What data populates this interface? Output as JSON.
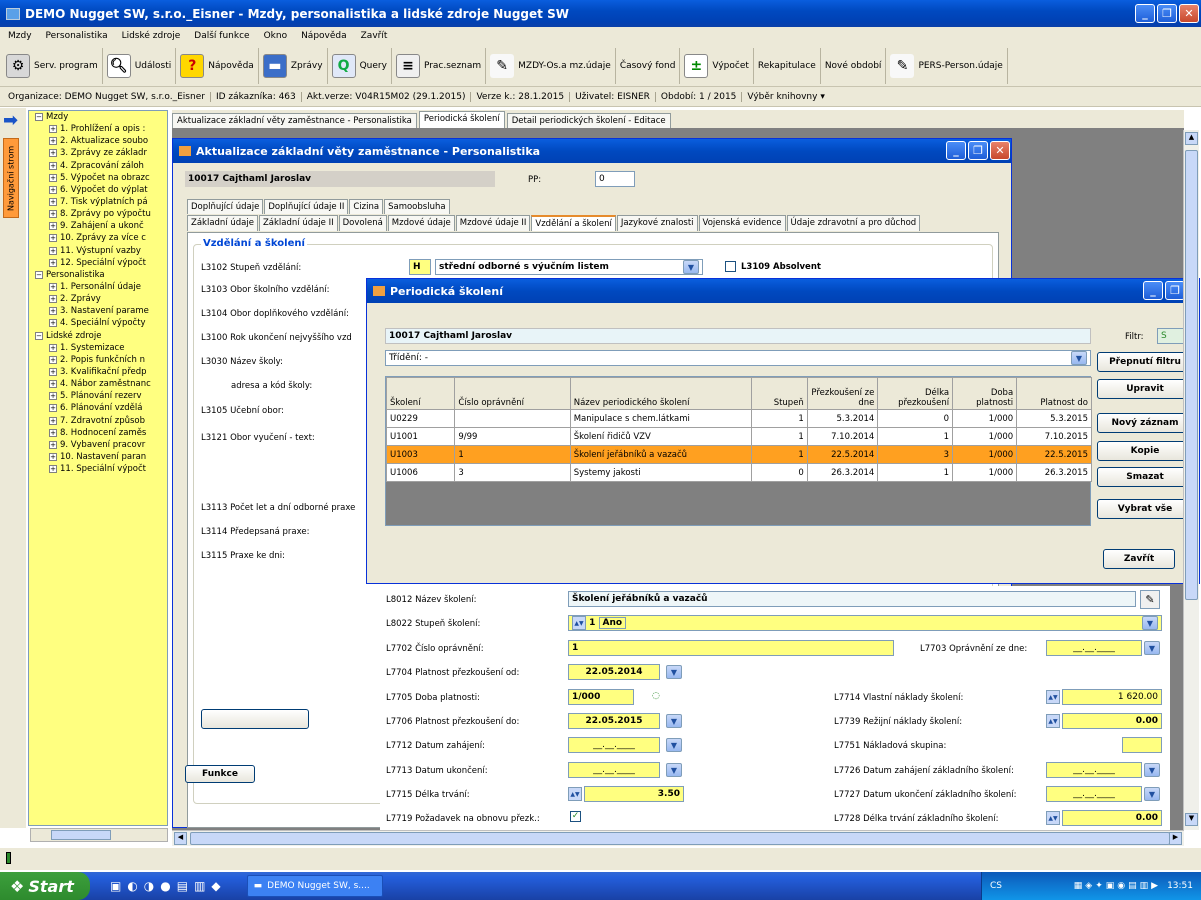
{
  "app": {
    "title": "DEMO Nugget SW, s.r.o._Eisner - Mzdy, personalistika a lidské zdroje Nugget SW"
  },
  "menu": [
    "Mzdy",
    "Personalistika",
    "Lidské zdroje",
    "Další funkce",
    "Okno",
    "Nápověda",
    "Zavřít"
  ],
  "toolbar": [
    {
      "label": "Serv. program",
      "icon": "tools-icon"
    },
    {
      "label": "Události",
      "icon": "magnifier-icon"
    },
    {
      "label": "Nápověda",
      "icon": "help-icon"
    },
    {
      "label": "Zprávy",
      "icon": "printer-icon"
    },
    {
      "label": "Query",
      "icon": "query-icon"
    },
    {
      "label": "Prac.seznam",
      "icon": "list-icon"
    },
    {
      "label": "MZDY-Os.a mz.údaje",
      "icon": "pen-icon"
    },
    {
      "label": "Časový fond",
      "icon": ""
    },
    {
      "label": "Výpočet",
      "icon": "calc-icon"
    },
    {
      "label": "Rekapitulace",
      "icon": ""
    },
    {
      "label": "Nové období",
      "icon": ""
    },
    {
      "label": "PERS-Person.údaje",
      "icon": "pen-icon"
    }
  ],
  "infobar": [
    "Organizace: DEMO Nugget SW, s.r.o._Eisner",
    "ID zákazníka: 463",
    "Akt.verze: V04R15M02 (29.1.2015)",
    "Verze k.: 28.1.2015",
    "Uživatel: EISNER",
    "Období: 1 / 2015",
    "Výběr knihovny ▾"
  ],
  "nav": {
    "tab_label": "Navigační strom"
  },
  "tree": [
    {
      "t": "Mzdy",
      "lvl": 0,
      "sign": "−"
    },
    {
      "t": "1. Prohlížení a opis :",
      "lvl": 1,
      "sign": "+"
    },
    {
      "t": "2. Aktualizace soubo",
      "lvl": 1,
      "sign": "+"
    },
    {
      "t": "3. Zprávy ze základr",
      "lvl": 1,
      "sign": "+"
    },
    {
      "t": "4. Zpracování záloh",
      "lvl": 1,
      "sign": "+"
    },
    {
      "t": "5. Výpočet na obrazc",
      "lvl": 1,
      "sign": "+"
    },
    {
      "t": "6. Výpočet do výplat",
      "lvl": 1,
      "sign": "+"
    },
    {
      "t": "7. Tisk výplatních pá",
      "lvl": 1,
      "sign": "+"
    },
    {
      "t": "8. Zprávy po výpočtu",
      "lvl": 1,
      "sign": "+"
    },
    {
      "t": "9. Zahájení a ukonč",
      "lvl": 1,
      "sign": "+"
    },
    {
      "t": "10. Zprávy za více c",
      "lvl": 1,
      "sign": "+"
    },
    {
      "t": "11. Výstupní vazby",
      "lvl": 1,
      "sign": "+"
    },
    {
      "t": "12. Speciální výpočt",
      "lvl": 1,
      "sign": "+"
    },
    {
      "t": "Personalistika",
      "lvl": 0,
      "sign": "−"
    },
    {
      "t": "1. Personální údaje",
      "lvl": 1,
      "sign": "+"
    },
    {
      "t": "2. Zprávy",
      "lvl": 1,
      "sign": "+"
    },
    {
      "t": "3. Nastavení parame",
      "lvl": 1,
      "sign": "+"
    },
    {
      "t": "4. Speciální výpočty",
      "lvl": 1,
      "sign": "+"
    },
    {
      "t": "Lidské zdroje",
      "lvl": 0,
      "sign": "−"
    },
    {
      "t": "1. Systemizace",
      "lvl": 1,
      "sign": "+"
    },
    {
      "t": "2. Popis funkčních n",
      "lvl": 1,
      "sign": "+"
    },
    {
      "t": "3. Kvalifikační předp",
      "lvl": 1,
      "sign": "+"
    },
    {
      "t": "4. Nábor zaměstnanc",
      "lvl": 1,
      "sign": "+"
    },
    {
      "t": "5. Plánování rezerv",
      "lvl": 1,
      "sign": "+"
    },
    {
      "t": "6. Plánování vzdělá",
      "lvl": 1,
      "sign": "+"
    },
    {
      "t": "7. Zdravotní způsob",
      "lvl": 1,
      "sign": "+"
    },
    {
      "t": "8. Hodnocení zaměs",
      "lvl": 1,
      "sign": "+"
    },
    {
      "t": "9. Vybavení pracovr",
      "lvl": 1,
      "sign": "+"
    },
    {
      "t": "10. Nastavení paran",
      "lvl": 1,
      "sign": "+"
    },
    {
      "t": "11. Speciální výpočt",
      "lvl": 1,
      "sign": "+"
    }
  ],
  "mditabs": [
    "Aktualizace základní věty zaměstnance - Personalistika",
    "Periodická školení",
    "Detail periodických školení - Editace"
  ],
  "win1": {
    "title": "Aktualizace základní věty zaměstnance - Personalistika",
    "employee": "10017   Cajthaml Jaroslav",
    "pp_label": "PP:",
    "pp_value": "0",
    "tabs1": [
      "Doplňující údaje",
      "Doplňující údaje II",
      "Cizina",
      "Samoobsluha"
    ],
    "tabs2": [
      "Základní údaje",
      "Základní údaje II",
      "Dovolená",
      "Mzdové údaje",
      "Mzdové údaje II",
      "Vzdělání a školení",
      "Jazykové znalosti",
      "Vojenská evidence",
      "Údaje zdravotní a pro důchod"
    ],
    "group": "Vzdělání a školení",
    "l3102": "L3102 Stupeň vzdělání:",
    "l3102_code": "H",
    "l3102_value": "střední odborné s výučním listem",
    "l3109": "L3109 Absolvent",
    "l3103": "L3103 Obor školního vzdělání:",
    "l3104": "L3104 Obor doplňkového vzdělání:",
    "l3100": "L3100 Rok ukončení nejvyššího vzd",
    "l3030": "L3030 Název školy:",
    "adresa": "adresa a kód školy:",
    "l3105": "L3105 Učební obor:",
    "l3121": "L3121 Obor vyučení - text:",
    "l3113": "L3113 Počet let a dní odborné praxe",
    "l3114": "L3114 Předepsaná praxe:",
    "l3115": "L3115 Praxe ke dni:",
    "funkce": "Funkce"
  },
  "win2": {
    "title": "Periodická školení",
    "employee": "10017   Cajthaml Jaroslav",
    "filtr_label": "Filtr:",
    "filtr_value": "S",
    "trideni": "Třídění: -",
    "cols": [
      "Školení",
      "Číslo oprávnění",
      "Název periodického školení",
      "Stupeň",
      "Přezkoušení ze dne",
      "Délka přezkoušení",
      "Doba platnosti",
      "Platnost do"
    ],
    "rows": [
      [
        "U0229",
        "",
        "Manipulace s chem.látkami",
        "1",
        "5.3.2014",
        "0",
        "1/000",
        "5.3.2015"
      ],
      [
        "U1001",
        "9/99",
        "Školení řidičů VZV",
        "1",
        "7.10.2014",
        "1",
        "1/000",
        "7.10.2015"
      ],
      [
        "U1003",
        "1",
        "Školení jeřábníků a vazačů",
        "1",
        "22.5.2014",
        "3",
        "1/000",
        "22.5.2015"
      ],
      [
        "U1006",
        "3",
        "Systemy jakosti",
        "0",
        "26.3.2014",
        "1",
        "1/000",
        "26.3.2015"
      ]
    ],
    "selected_row": 2,
    "buttons": [
      "Přepnutí filtru",
      "Upravit",
      "Nový záznam",
      "Kopie",
      "Smazat",
      "Vybrat vše"
    ],
    "close": "Zavřít"
  },
  "detail": {
    "l8012": "L8012 Název školení:",
    "l8012_v": "Školení jeřábníků a vazačů",
    "l8022": "L8022 Stupeň školení:",
    "l8022_n": "1",
    "l8022_v": "Ano",
    "l7702": "L7702 Číslo oprávnění:",
    "l7702_v": "1",
    "l7703": "L7703 Oprávnění ze dne:",
    "date_empty": "__.__.____",
    "l7704": "L7704 Platnost přezkoušení od:",
    "l7704_v": "22.05.2014",
    "l7705": "L7705 Doba platnosti:",
    "l7705_v": "1/000",
    "l7714": "L7714 Vlastní náklady školení:",
    "l7714_v": "1 620.00",
    "l7706": "L7706 Platnost přezkoušení do:",
    "l7706_v": "22.05.2015",
    "l7739": "L7739 Režijní náklady školení:",
    "l7739_v": "0.00",
    "l7712": "L7712 Datum zahájení:",
    "l7751": "L7751 Nákladová skupina:",
    "l7713": "L7713 Datum ukončení:",
    "l7726": "L7726 Datum zahájení základního školení:",
    "l7715": "L7715 Délka trvání:",
    "l7715_v": "3.50",
    "l7727": "L7727 Datum ukončení základního školení:",
    "l7719": "L7719 Požadavek na obnovu přezk.:",
    "l7728": "L7728 Délka trvání základního školení:",
    "l7728_v": "0.00"
  },
  "taskbar": {
    "start": "Start",
    "task": "DEMO Nugget SW, s....",
    "lang": "CS",
    "time": "13:51"
  }
}
